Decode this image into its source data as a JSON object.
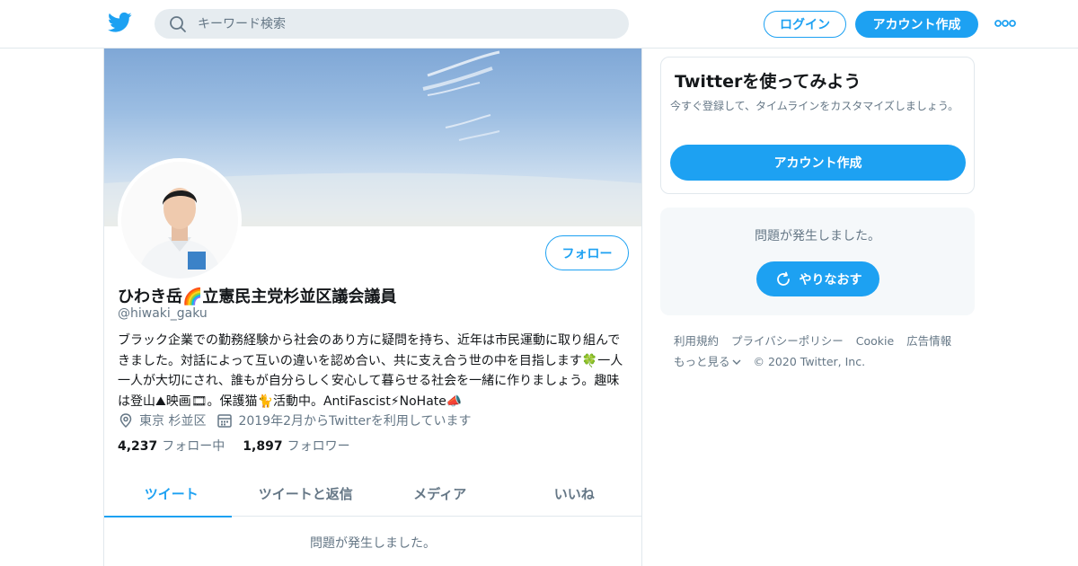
{
  "header": {
    "search_placeholder": "キーワード検索",
    "login_label": "ログイン",
    "signup_label": "アカウント作成"
  },
  "profile": {
    "follow_label": "フォロー",
    "name": "ひわき岳🌈立憲民主党杉並区議会議員",
    "handle": "@hiwaki_gaku",
    "bio": "ブラック企業での勤務経験から社会のあり方に疑問を持ち、近年は市民運動に取り組んできました。対話によって互いの違いを認め合い、共に支え合う世の中を目指します🍀一人一人が大切にされ、誰もが自分らしく安心して暮らせる社会を一緒に作りましょう。趣味は登山⛰映画🎞。保護猫🐈活動中。AntiFascist⚡NoHate📣",
    "location": "東京 杉並区",
    "joined": "2019年2月からTwitterを利用しています",
    "following_count": "4,237",
    "following_label": "フォロー中",
    "followers_count": "1,897",
    "followers_label": "フォロワー",
    "tabs": [
      {
        "label": "ツイート"
      },
      {
        "label": "ツイートと返信"
      },
      {
        "label": "メディア"
      },
      {
        "label": "いいね"
      }
    ],
    "feed_error": "問題が発生しました。"
  },
  "sidebar": {
    "signup_card": {
      "title": "Twitterを使ってみよう",
      "description": "今すぐ登録して、タイムラインをカスタマイズしましょう。",
      "button_label": "アカウント作成"
    },
    "error_card": {
      "message": "問題が発生しました。",
      "retry_label": "やりなおす"
    },
    "footer": {
      "links": [
        "利用規約",
        "プライバシーポリシー",
        "Cookie",
        "広告情報"
      ],
      "more_label": "もっと見る",
      "copyright": "© 2020 Twitter, Inc."
    }
  },
  "colors": {
    "accent": "#1da1f2",
    "text": "#14171a",
    "muted": "#657786",
    "border": "#e1e8ed"
  },
  "icons": [
    "twitter-bird-icon",
    "search-icon",
    "more-dots-icon",
    "location-icon",
    "calendar-icon",
    "retry-icon",
    "chevron-down-icon"
  ]
}
